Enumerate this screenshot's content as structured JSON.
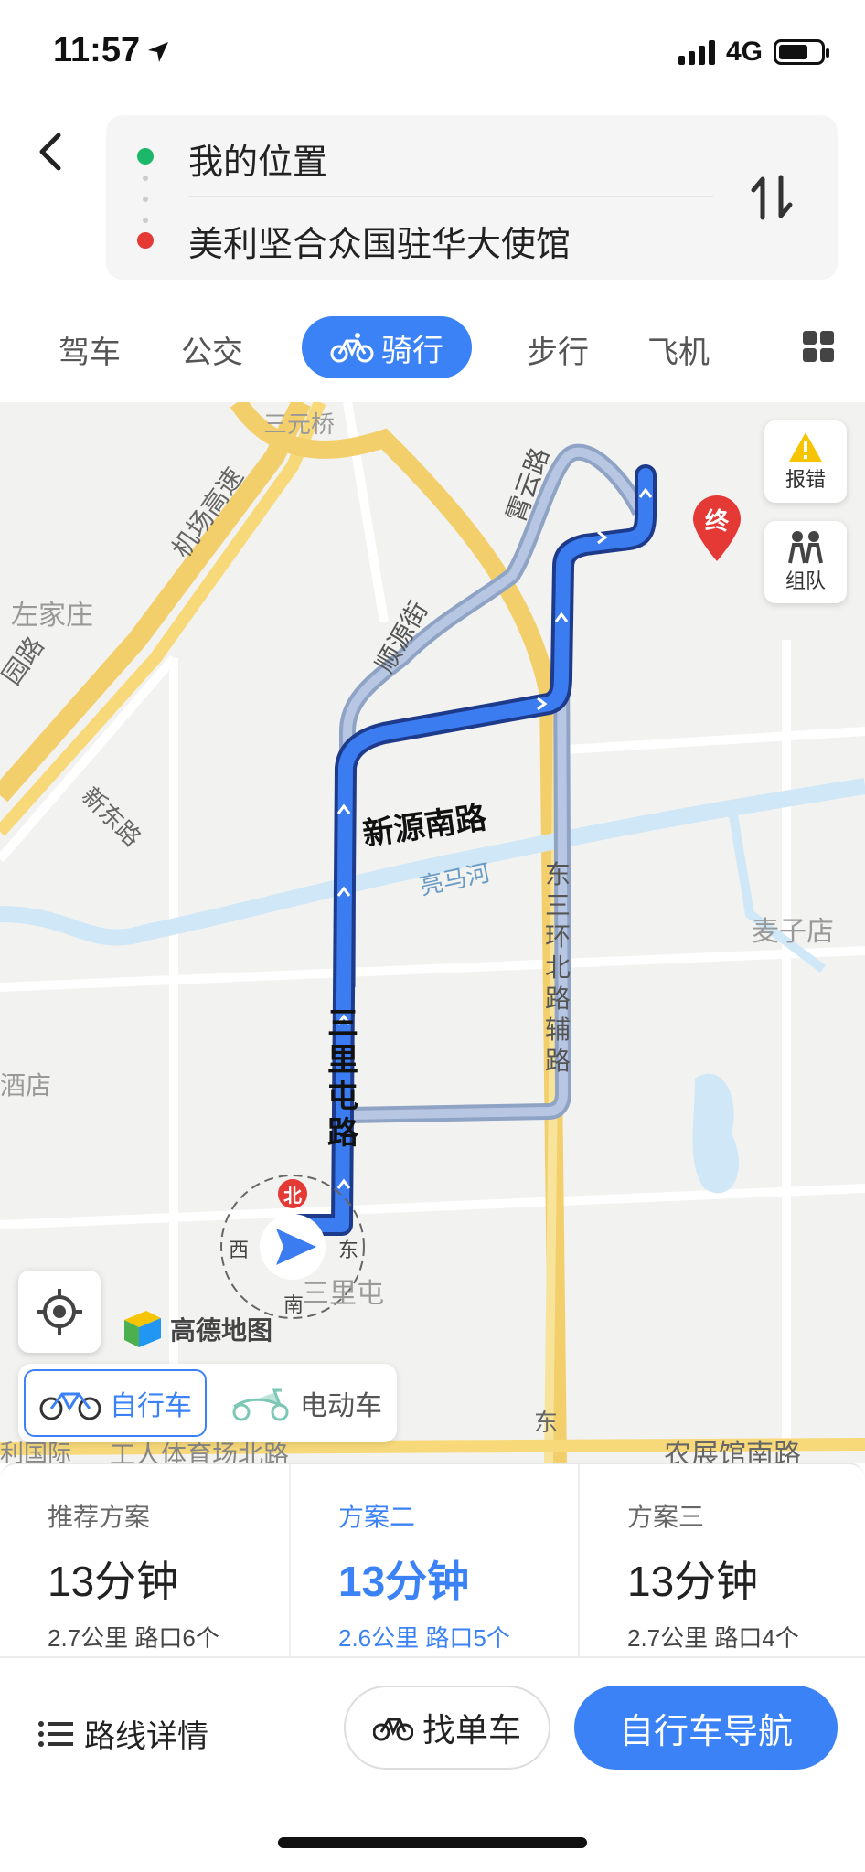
{
  "status_bar": {
    "time": "11:57",
    "network": "4G"
  },
  "route": {
    "from": "我的位置",
    "to": "美利坚合众国驻华大使馆"
  },
  "modes": {
    "drive": "驾车",
    "transit": "公交",
    "ride": "骑行",
    "walk": "步行",
    "plane": "飞机"
  },
  "map": {
    "labels": {
      "sanyuanqiao": "三元桥",
      "airport_expressway": "机场高速",
      "zuojiazhuang": "左家庄",
      "road_edge": "园路",
      "xindong_road": "新东路",
      "shunyuan_street": "顺源街",
      "yunxiao_road": "霄云路",
      "xinyuan_south_road": "新源南路",
      "liangma_river": "亮马河",
      "east_3rd_ring_aux": "东三环北路辅路",
      "maizidian": "麦子店",
      "sanlitun_road": "三里屯路",
      "hotel": "酒店",
      "sanlitun": "三里屯",
      "gongti_north": "工人体育场北路",
      "li_international": "利国际",
      "nongzhanguan_south": "农展馆南路",
      "dong": "东"
    },
    "compass": {
      "north": "北",
      "south": "南",
      "east": "东",
      "west": "西"
    },
    "end_marker": "终",
    "report_error": "报错",
    "team": "组队",
    "logo_text": "高德地图"
  },
  "vehicle": {
    "bicycle": "自行车",
    "ebike": "电动车"
  },
  "plans": [
    {
      "label": "推荐方案",
      "time": "13分钟",
      "detail": "2.7公里  路口6个"
    },
    {
      "label": "方案二",
      "time": "13分钟",
      "detail": "2.6公里  路口5个"
    },
    {
      "label": "方案三",
      "time": "13分钟",
      "detail": "2.7公里  路口4个"
    }
  ],
  "actions": {
    "details": "路线详情",
    "find_bike": "找单车",
    "navigate": "自行车导航"
  },
  "colors": {
    "accent": "#3b82f6",
    "start_dot": "#1bb86a",
    "end_dot": "#e53935"
  }
}
